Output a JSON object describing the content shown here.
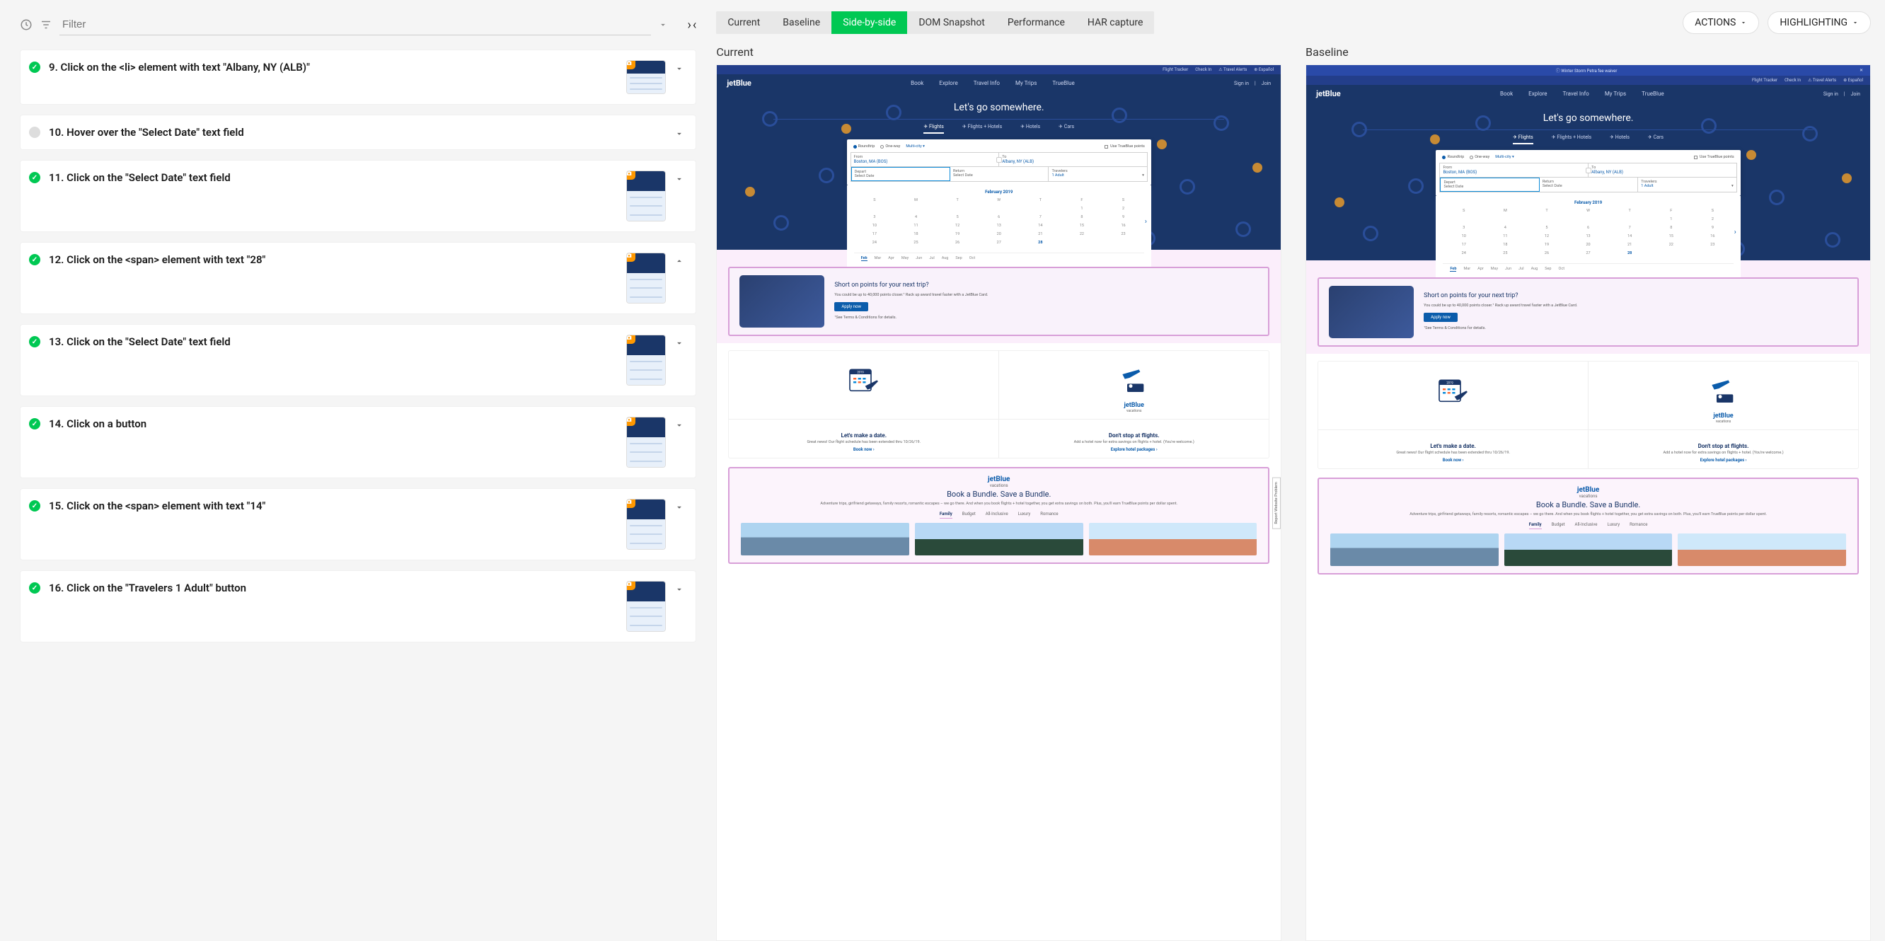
{
  "filter": {
    "placeholder": "Filter"
  },
  "tabs": [
    "Current",
    "Baseline",
    "Side-by-side",
    "DOM Snapshot",
    "Performance",
    "HAR capture"
  ],
  "active_tab": "Side-by-side",
  "top_buttons": {
    "actions": "ACTIONS",
    "highlighting": "HIGHLIGHTING"
  },
  "compare": {
    "current": "Current",
    "baseline": "Baseline"
  },
  "steps": [
    {
      "status": "pass",
      "text": "9. Click on the <li> element with text \"Albany, NY (ALB)\"",
      "thumb": true,
      "expanded": false,
      "tall": false
    },
    {
      "status": "neutral",
      "text": "10. Hover over the \"Select Date\" text field",
      "thumb": false,
      "expanded": false,
      "tall": false
    },
    {
      "status": "pass",
      "text": "11. Click on the \"Select Date\" text field",
      "thumb": true,
      "expanded": false,
      "tall": true
    },
    {
      "status": "pass",
      "text": "12. Click on the <span> element with text \"28\"",
      "thumb": true,
      "expanded": true,
      "tall": true
    },
    {
      "status": "pass",
      "text": "13. Click on the \"Select Date\" text field",
      "thumb": true,
      "expanded": false,
      "tall": true
    },
    {
      "status": "pass",
      "text": "14. Click on a button",
      "thumb": true,
      "expanded": false,
      "tall": true
    },
    {
      "status": "pass",
      "text": "15. Click on the <span> element with text \"14\"",
      "thumb": true,
      "expanded": false,
      "tall": true
    },
    {
      "status": "pass",
      "text": "16. Click on the \"Travelers 1 Adult\" button",
      "thumb": true,
      "expanded": false,
      "tall": true
    }
  ],
  "jetblue": {
    "topbar": [
      "Flight Tracker",
      "Check In",
      "Travel Alerts",
      "Español"
    ],
    "notice": "Winter Storm Petra fee waiver",
    "nav": [
      "Book",
      "Explore",
      "Travel Info",
      "My Trips",
      "TrueBlue"
    ],
    "auth": {
      "signin": "Sign in",
      "join": "Join"
    },
    "heading": "Let's go somewhere.",
    "search_tabs": [
      "Flights",
      "Flights + Hotels",
      "Hotels",
      "Cars"
    ],
    "trip": {
      "rt": "Roundtrip",
      "ow": "One-way",
      "mc": "Multi-city"
    },
    "use_points": "Use TrueBlue points",
    "from_label": "From",
    "from": "Boston, MA (BOS)",
    "to_label": "To",
    "to": "Albany, NY (ALB)",
    "depart_label": "Depart",
    "depart": "Select Date",
    "return_label": "Return",
    "return": "Select Date",
    "trav_label": "Travelers",
    "trav": "1 Adult",
    "cal_title": "February 2019",
    "cal_days": [
      "S",
      "M",
      "T",
      "W",
      "T",
      "F",
      "S"
    ],
    "cal_cells": [
      "",
      "",
      "",
      "",
      "",
      "1",
      "2",
      "3",
      "4",
      "5",
      "6",
      "7",
      "8",
      "9",
      "10",
      "11",
      "12",
      "13",
      "14",
      "15",
      "16",
      "17",
      "18",
      "19",
      "20",
      "21",
      "22",
      "23",
      "24",
      "25",
      "26",
      "27",
      "28"
    ],
    "months": [
      "Feb",
      "Mar",
      "Apr",
      "May",
      "Jun",
      "Jul",
      "Aug",
      "Sep",
      "Oct"
    ],
    "promo": {
      "h": "Short on points for your next trip?",
      "s": "You could be up to 40,000 points closer.¹ Rack up award travel faster with a JetBlue Card.",
      "btn": "Apply now",
      "terms": "¹See Terms & Conditions for details."
    },
    "date_card": {
      "h": "Let's make a date.",
      "s": "Great news! Our flight schedule has been extended thru 10/26/19.",
      "cta": "Book now ›",
      "year": "2019"
    },
    "stay_card": {
      "h": "Don't stop at flights.",
      "s": "Add a hotel now for extra savings on flights + hotel. (You're welcome.)",
      "cta": "Explore hotel packages ›",
      "brand": "jetBlue",
      "brand2": "vacations"
    },
    "vac": {
      "brand": "jetBlue",
      "brand2": "vacations",
      "title": "Book a Bundle. Save a Bundle.",
      "desc": "Adventure trips, girlfriend getaways, family resorts, romantic escapes – we go there. And when you book flights + hotel together, you get extra savings on both. Plus, you'll earn TrueBlue points per dollar spent.",
      "tabs": [
        "Family",
        "Budget",
        "All-Inclusive",
        "Luxury",
        "Romance"
      ]
    },
    "feedback": "Report Website Problem"
  }
}
